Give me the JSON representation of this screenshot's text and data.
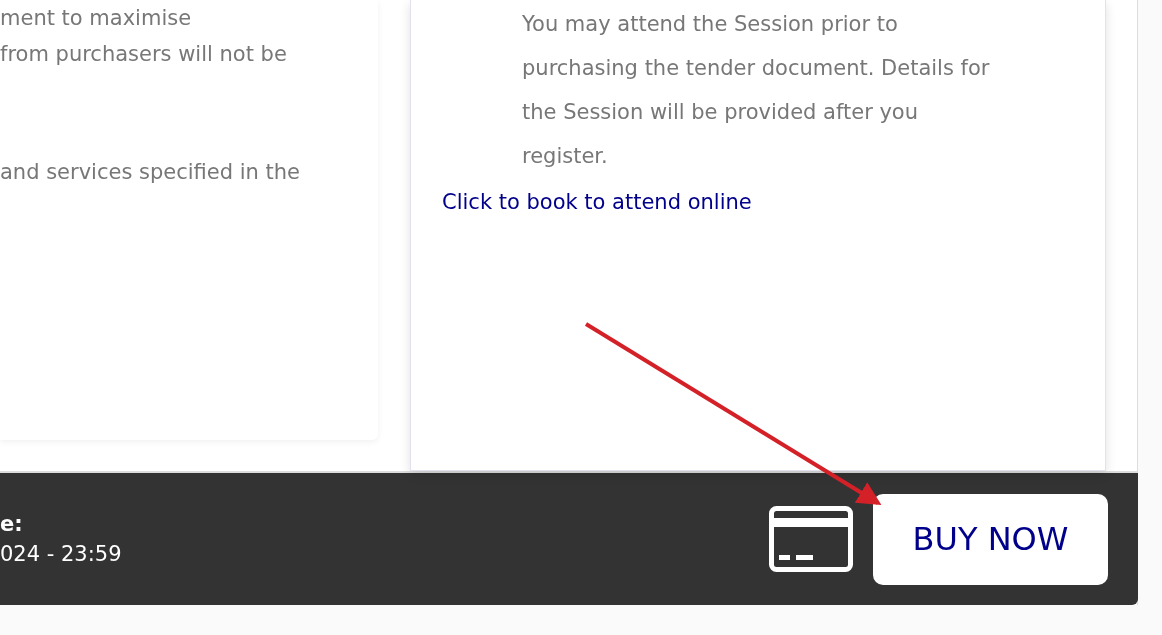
{
  "description_card": {
    "paragraphs": [
      {
        "lines": [
          "ment to maximise",
          "from purchasers will not be"
        ]
      },
      {
        "lines": [
          "and services specified in the"
        ]
      }
    ]
  },
  "briefing_card": {
    "lines": [
      "You may attend the Session prior to",
      "purchasing the tender document. Details for",
      "the Session will be provided after you",
      "register."
    ],
    "link": "Click to book to attend online"
  },
  "purchase_bar": {
    "closing_label": "e:",
    "closing_value": "024 - 23:59",
    "buy_button": "BUY NOW"
  }
}
